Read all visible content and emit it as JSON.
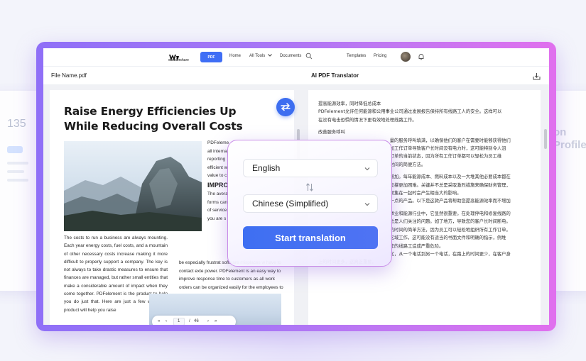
{
  "side_cards": {
    "left_number": "135",
    "right_lines": [
      "on",
      "Profile"
    ]
  },
  "nav": {
    "brand_name": "wondershare",
    "product_badge": "PDF",
    "links": [
      "Home",
      "All Tools",
      "Documents"
    ],
    "right_links": [
      "Templates",
      "Pricing"
    ]
  },
  "left_pane": {
    "file_name": "File Name.pdf"
  },
  "right_pane": {
    "title": "AI PDF Translator"
  },
  "document": {
    "title": "Raise Energy Efficiencies Up While Reducing Overall Costs",
    "paragraph": "The costs to run a business are always mounting. Each year energy costs, fuel costs, and a mountain of other necessary costs increase making it more difficult to properly support a company. The key is not always to take drastic measures to ensure that finances are managed, but rather small entities that make a considerable amount of impact when they come together. PDFelement is the product to help you do just that. Here are just a few ways this product will help you raise",
    "col2_lines": [
      "PDFeleme",
      "all internal",
      "reporting",
      "efficient w",
      "value to c"
    ],
    "col2_heading": "IMPRO",
    "col2_lines_2": [
      "The avera",
      "forms can",
      "of service",
      "you are s"
    ],
    "col2_bottom": "be especially frustrat software misplaces w have to contact exte power. PDFelement is an easy way to improve response time to customers as all work orders can be organized easily for the employees to"
  },
  "pager": {
    "first": "«",
    "prev": "‹",
    "current": "1",
    "sep": "/",
    "total": "46",
    "next": "›",
    "last": "»"
  },
  "translation": {
    "lines": [
      "提高能源效率，同时降低总成本",
      "PDFelement允许任何能源和公用事业公司通过发展报告保持所有线路工人的安全。这样可以",
      "在没有电击恐惧的情况下更有效地处理线路工作。",
      "",
      "改善服务呼叫",
      "　　　　　　　　　　　　　　　　量的服务呼叫填满，以确保他们的客户在需要时能够获得他们",
      "　　　　　　　　　　　　　　　　加工作订单导致客户长时间没有电力时，这可能特别令人沮",
      "　　　　　　　　　　　　　　　　订单的当前状态，因为所有工作订单都可以轻松为员工维",
      "　　　　　　　　　　　　　　　　时间的简便方法。",
      "",
      "　　　　　　　　　　　　　　　　增加。每年能源成本、燃料成本以及一大堆其他必要成本都在",
      "　　　　　　　　　　　　　　　　支撑更加困难。关键并不总是采取激烈措施来确保财务管理，",
      "　　　　　　　　　　　　　　　　聚集在一起时会产生相当大的影响。",
      "　　　　　　　　　　　　　　　　一点的产品。以下是这款产品将帮助您提高能源效率而不增加",
      "",
      "　　　　　　　　　　　　　　　　事业和能源行业中，它显然很重要。在处理停电和修复线路的",
      "　　　　　　　　　　　　　　　　总是人们关注的问题。如了地方，导致您的客户长时间断电。",
      "　　　　　　　　　　　　　　　　的时间的简单方法，因为员工可以轻松地组织所有工作订单。",
      "　　　　　　　　　　　　　　　　区域工作，这可能没有适当的书面文件和明确的指示，例堆",
      "　　　　　　　　　　　　　　　　作的线路工造成严重危险。",
      "　　　　　　　　　　　　　　　　区，从一个电话到另一个电话，在路上的时间更少，在客户身",
      "上的时间更多，这真正重要。"
    ]
  },
  "dialog": {
    "source_language": "English",
    "target_language": "Chinese (Simplified)",
    "start_label": "Start translation"
  },
  "colors": {
    "frame_start": "#8f6ff7",
    "frame_end": "#e070ee",
    "accent_blue": "#3e6ff2"
  }
}
